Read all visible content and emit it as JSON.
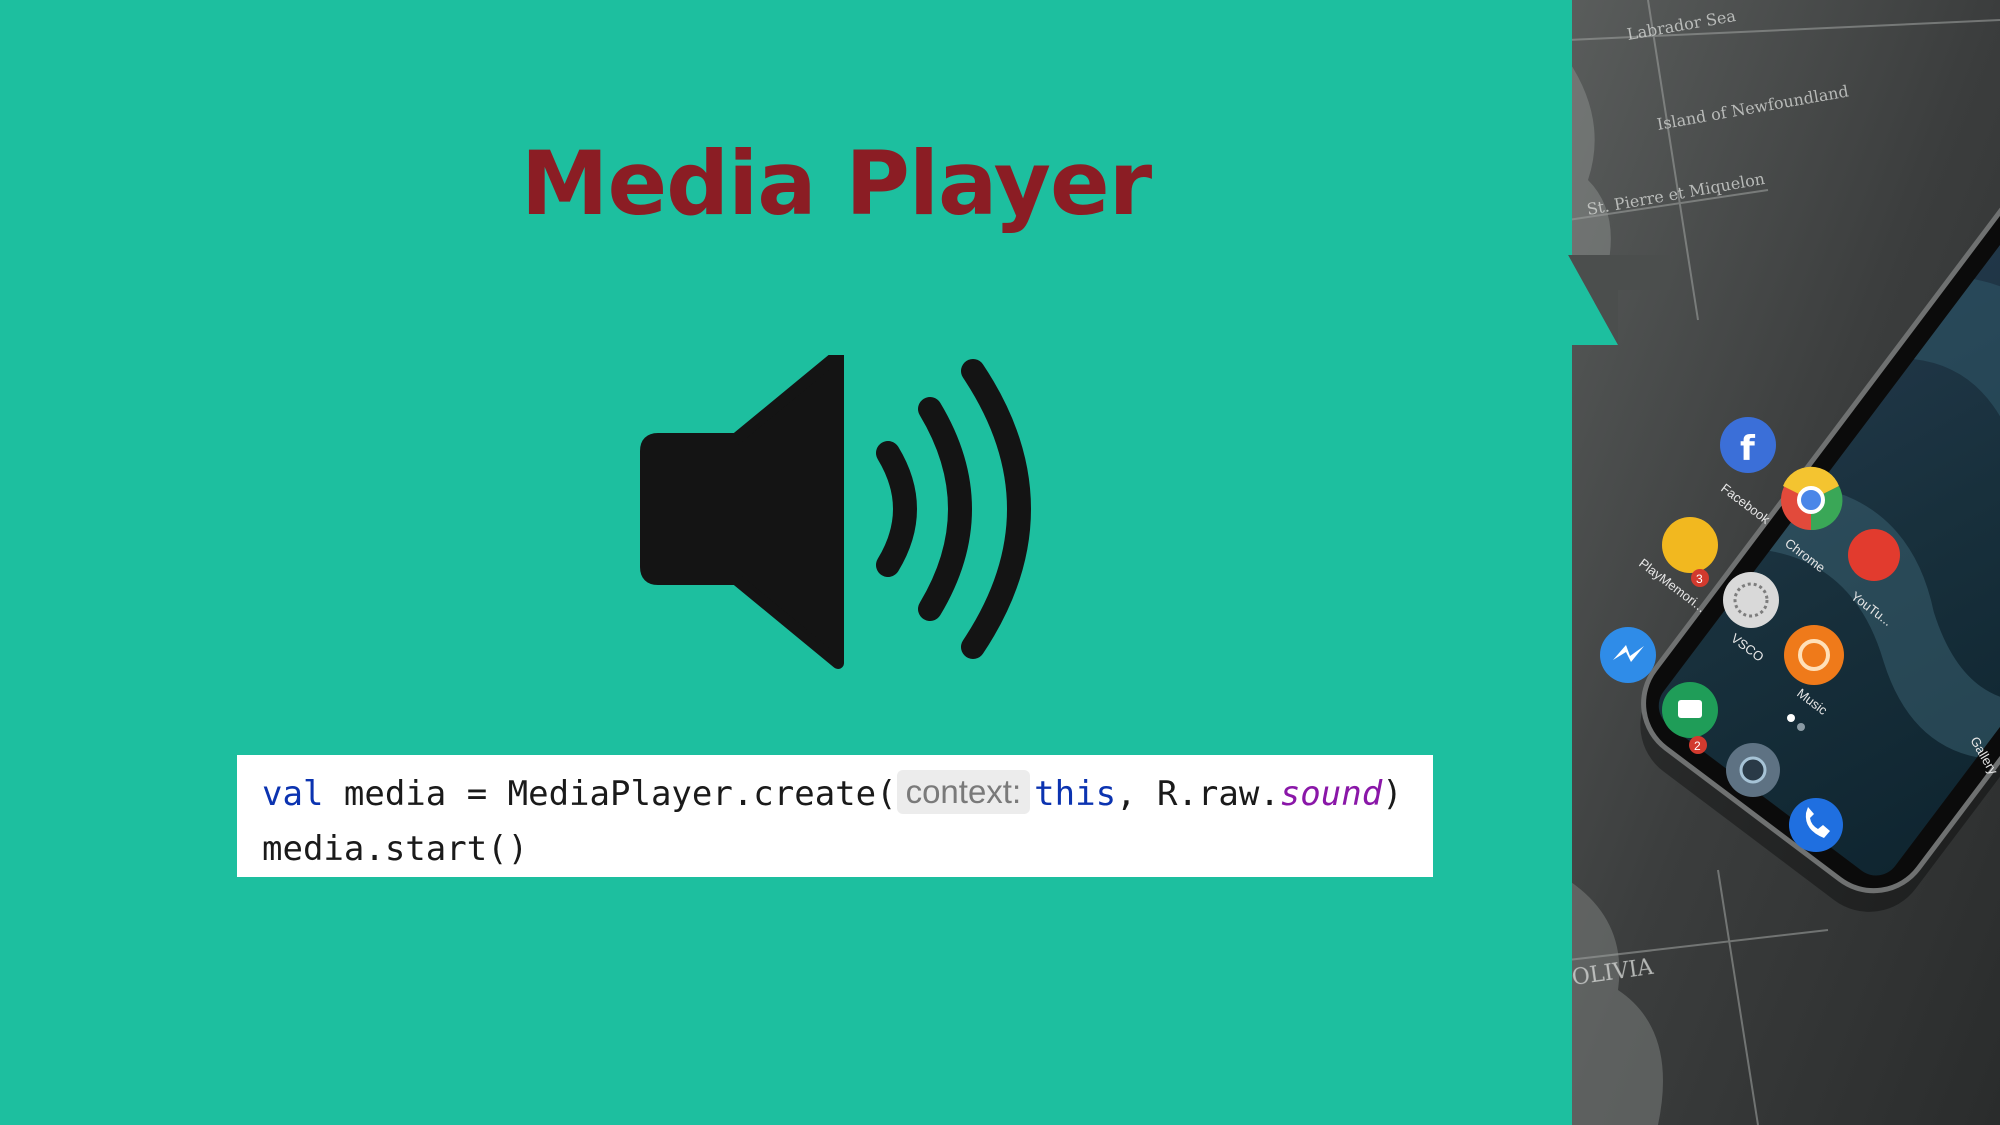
{
  "slide": {
    "title": "Media Player",
    "background_color": "#1dbf9f",
    "title_color": "#8b1d24"
  },
  "icon": "speaker-volume-icon",
  "code": {
    "line1": {
      "keyword": "val",
      "text_a": " media = MediaPlayer.create(",
      "param_hint": "context:",
      "this_kw": "this",
      "text_b": ", R.raw.",
      "resource": "sound",
      "text_c": ")"
    },
    "line2": "media.start()"
  },
  "photo": {
    "map_labels": [
      "Labrador Sea",
      "Island of Newfoundland",
      "St. Pierre et Miquelon",
      "OLIVIA"
    ],
    "apps": [
      "Facebook",
      "Chrome",
      "PlayMemori...",
      "VSCO",
      "Music",
      "YouTu...",
      "Gallery"
    ],
    "badges": [
      "3",
      "2"
    ]
  }
}
